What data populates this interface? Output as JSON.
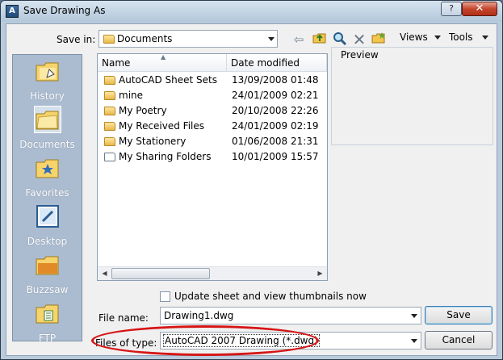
{
  "window": {
    "title": "Save Drawing As",
    "help_glyph": "?",
    "close_glyph": "✕"
  },
  "toolbar": {
    "save_in_label": "Save in:",
    "save_in_value": "Documents",
    "views_label": "Views",
    "tools_label": "Tools"
  },
  "places": [
    {
      "label": "History",
      "icon": "history-folder-icon"
    },
    {
      "label": "Documents",
      "icon": "documents-folder-icon"
    },
    {
      "label": "Favorites",
      "icon": "favorites-folder-icon"
    },
    {
      "label": "Desktop",
      "icon": "desktop-icon"
    },
    {
      "label": "Buzzsaw",
      "icon": "buzzsaw-folder-icon"
    },
    {
      "label": "FTP",
      "icon": "ftp-folder-icon"
    }
  ],
  "filelist": {
    "columns": {
      "name": "Name",
      "date": "Date modified"
    },
    "rows": [
      {
        "name": "AutoCAD Sheet Sets",
        "date": "13/09/2008 01:48"
      },
      {
        "name": "mine",
        "date": "24/01/2009 02:21"
      },
      {
        "name": "My Poetry",
        "date": "20/10/2008 22:26"
      },
      {
        "name": "My Received Files",
        "date": "24/01/2009 02:19"
      },
      {
        "name": "My Stationery",
        "date": "01/06/2008 21:31"
      },
      {
        "name": "My Sharing Folders",
        "date": "10/01/2009 15:57"
      }
    ]
  },
  "preview": {
    "label": "Preview"
  },
  "options": {
    "thumbnails_label": "Update sheet and view thumbnails now"
  },
  "form": {
    "file_name_label": "File name:",
    "file_name_value": "Drawing1.dwg",
    "file_type_label": "Files of type:",
    "file_type_value": "AutoCAD 2007 Drawing (*.dwg)",
    "save_label": "Save",
    "cancel_label": "Cancel"
  },
  "colors": {
    "highlight_ellipse": "#d61515",
    "places_bar": "#acbcd0"
  }
}
